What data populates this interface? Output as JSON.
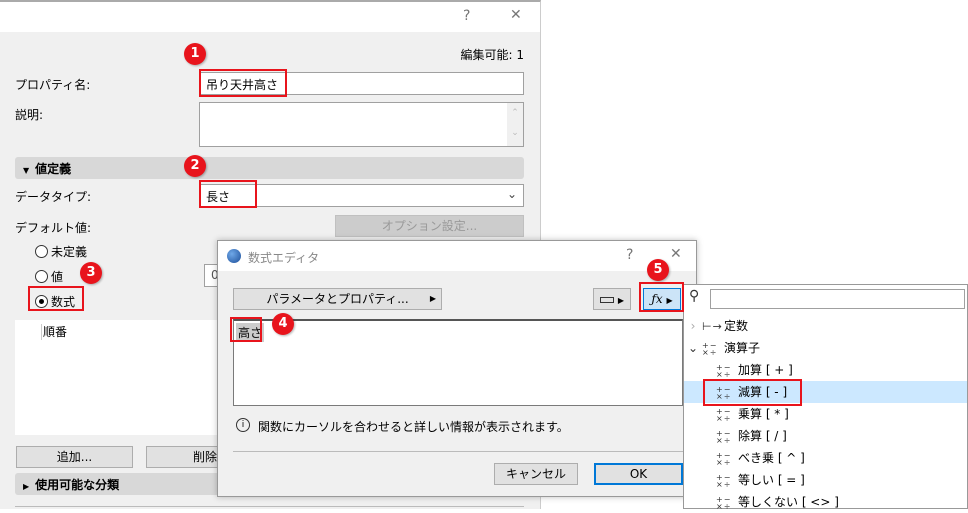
{
  "main_dialog": {
    "help_label": "?",
    "close_label": "✕",
    "editable_count": "編集可能: 1",
    "property_name_label": "プロパティ名:",
    "property_name_value": "吊り天井高さ",
    "description_label": "説明:",
    "value_definition_section": "値定義",
    "data_type_label": "データタイプ:",
    "data_type_value": "長さ",
    "default_value_label": "デフォルト値:",
    "option_settings_button": "オプション設定...",
    "radio_undefined": "未定義",
    "radio_value": "値",
    "value_input": "0",
    "radio_formula": "数式",
    "list_item": "順番",
    "add_button": "追加...",
    "delete_button": "削除",
    "available_classes_section": "使用可能な分類"
  },
  "formula_editor": {
    "title": "数式エディタ",
    "help_label": "?",
    "close_label": "✕",
    "params_button": "パラメータとプロパティ...",
    "formula_token": "高さ",
    "info_text": "関数にカーソルを合わせると詳しい情報が表示されます。",
    "cancel_button": "キャンセル",
    "ok_button": "OK"
  },
  "function_dropdown": {
    "search_placeholder": "",
    "items": [
      {
        "label": "定数",
        "level": 0,
        "expander": "›"
      },
      {
        "label": "演算子",
        "level": 0,
        "expander": "⌄"
      },
      {
        "label": "加算 [ + ]",
        "level": 1
      },
      {
        "label": "減算 [ - ]",
        "level": 1,
        "selected": true
      },
      {
        "label": "乗算 [ * ]",
        "level": 1
      },
      {
        "label": "除算 [ / ]",
        "level": 1
      },
      {
        "label": "べき乗 [ ^ ]",
        "level": 1
      },
      {
        "label": "等しい [ = ]",
        "level": 1
      },
      {
        "label": "等しくない [ <> ]",
        "level": 1
      }
    ]
  },
  "annotations": [
    "1",
    "2",
    "3",
    "4",
    "5"
  ],
  "colors": {
    "annotation": "#e8141c",
    "selection": "#cce8ff",
    "accent": "#0078d7"
  }
}
